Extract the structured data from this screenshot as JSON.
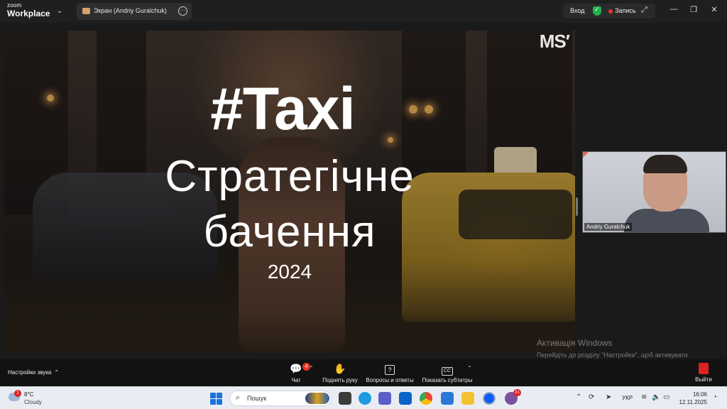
{
  "app": {
    "brand_small": "zoom",
    "brand_large": "Workplace"
  },
  "tab": {
    "label": "Экран (Andriy Guralchuk)",
    "more": "···"
  },
  "header": {
    "login": "Вход",
    "record": "Запись"
  },
  "slide": {
    "logo": "MS′",
    "title": "#Taxi",
    "line1": "Стратегічне",
    "line2": "бачення",
    "year": "2024"
  },
  "participant": {
    "name": "Andriy Guralchuk"
  },
  "watermark": {
    "title": "Активація Windows",
    "text": "Перейдіть до розділу \"Настройки\", щоб активувати Windows."
  },
  "toolbar": {
    "audio_settings": "Настройки звука",
    "chat_label": "Чат",
    "chat_badge": "4",
    "raise_hand_label": "Поднять руку",
    "qa_label": "Вопросы и ответы",
    "captions_label": "Показать субтитры",
    "leave_label": "Выйти"
  },
  "taskbar": {
    "weather_badge": "1",
    "temperature": "8°C",
    "condition": "Cloudy",
    "search_placeholder": "Пошук",
    "viber_badge": "31",
    "language": "УКР",
    "time": "16:06",
    "date": "12.11.2025"
  },
  "colors": {
    "accent_red": "#e33333",
    "shield_green": "#23b14d",
    "start_blue": "#1a73d9"
  }
}
